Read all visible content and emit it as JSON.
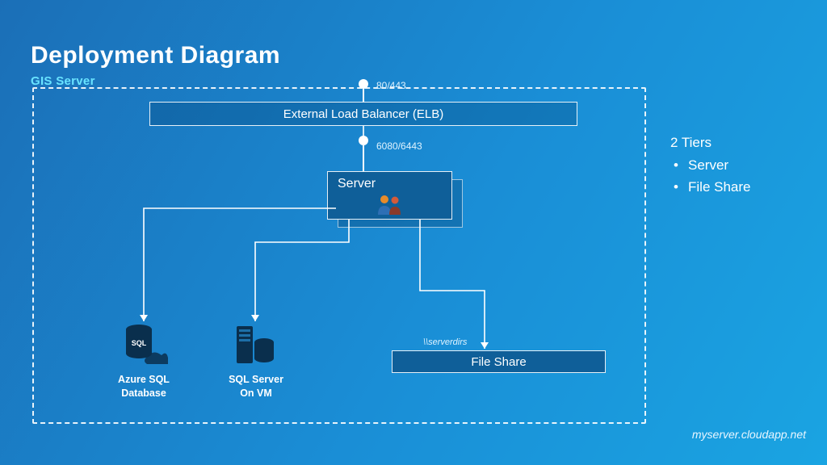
{
  "title": "Deployment Diagram",
  "subtitle": "GIS Server",
  "elb_label": "External Load Balancer (ELB)",
  "server_label": "Server",
  "fileshare_label": "File Share",
  "port_top": "80/443",
  "port_mid": "6080/6443",
  "fileshare_path": "\\\\serverdirs",
  "azure_sql_caption_l1": "Azure SQL",
  "azure_sql_caption_l2": "Database",
  "sqlvm_caption_l1": "SQL Server",
  "sqlvm_caption_l2": "On VM",
  "notes_title": "2 Tiers",
  "notes_items": [
    "Server",
    "File Share"
  ],
  "footer": "myserver.cloudapp.net"
}
